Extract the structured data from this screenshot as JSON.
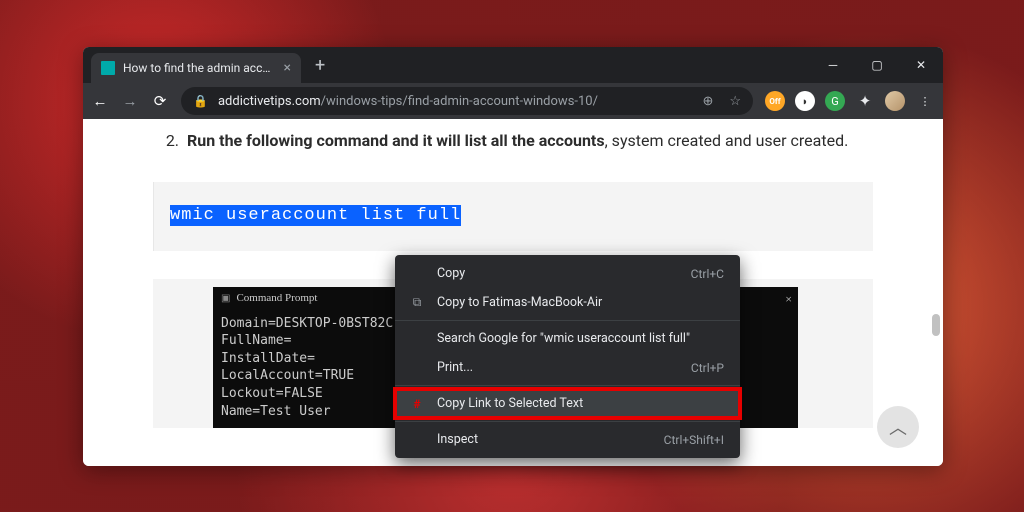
{
  "tab": {
    "title": "How to find the admin account o"
  },
  "url": {
    "domain": "addictivetips.com",
    "path": "/windows-tips/find-admin-account-windows-10/"
  },
  "ext_off_label": "Off",
  "article": {
    "list_number": "2.",
    "bold": "Run the following command and it will list all the accounts",
    "rest": ", system created and user created.",
    "code": "wmic useraccount list full"
  },
  "cmd": {
    "title": "Command Prompt",
    "lines": [
      "Domain=DESKTOP-0BST82C",
      "FullName=",
      "InstallDate=",
      "LocalAccount=TRUE",
      "Lockout=FALSE",
      "Name=Test User"
    ]
  },
  "ctx": {
    "copy": {
      "label": "Copy",
      "short": "Ctrl+C"
    },
    "copyto": {
      "label": "Copy to Fatimas-MacBook-Air"
    },
    "search": {
      "label": "Search Google for \"wmic useraccount list full\""
    },
    "print": {
      "label": "Print...",
      "short": "Ctrl+P"
    },
    "link": {
      "label": "Copy Link to Selected Text"
    },
    "inspect": {
      "label": "Inspect",
      "short": "Ctrl+Shift+I"
    }
  }
}
